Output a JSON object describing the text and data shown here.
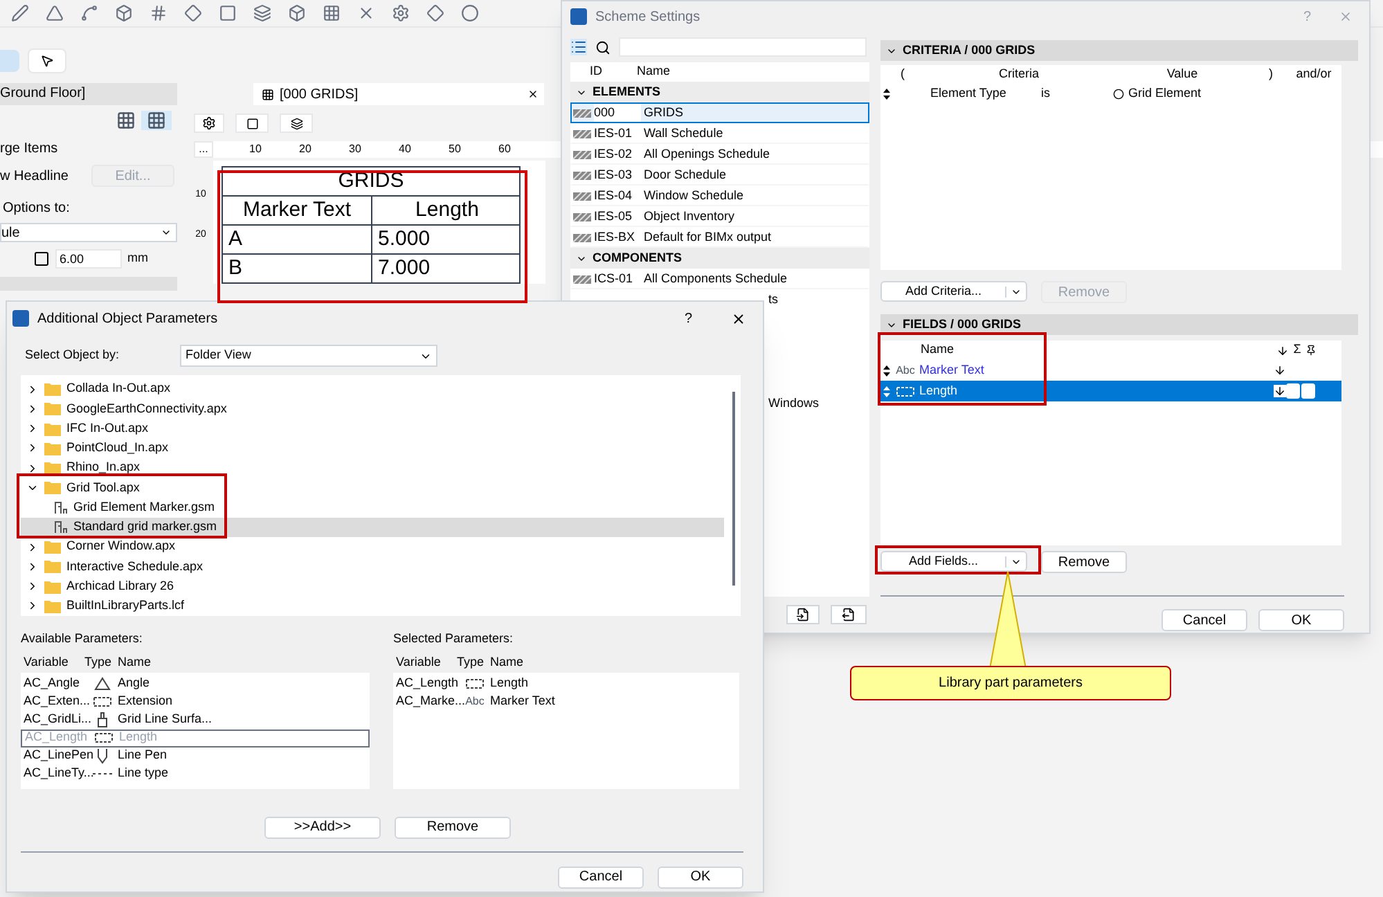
{
  "background": {
    "floor_tab": "Ground Floor]",
    "items_label": "rge Items",
    "headline_label": "w Headline",
    "edit_button": "Edit...",
    "options_label": "Options to:",
    "rule_dropdown": "ule",
    "height_value": "6.00",
    "unit": "mm",
    "view_tab": "[000 GRIDS]",
    "ruler_more": "...",
    "ruler_ticks": [
      "10",
      "20",
      "30",
      "40",
      "50",
      "60"
    ],
    "vruler_ticks": [
      "10",
      "20"
    ],
    "schedule": {
      "title": "GRIDS",
      "columns": [
        "Marker Text",
        "Length"
      ],
      "rows": [
        [
          "A",
          "5.000"
        ],
        [
          "B",
          "7.000"
        ]
      ]
    }
  },
  "scheme": {
    "title": "Scheme Settings",
    "help": "?",
    "columns": [
      "ID",
      "Name"
    ],
    "groups": [
      {
        "name": "ELEMENTS",
        "expanded": true,
        "items": [
          {
            "id": "000",
            "name": "GRIDS",
            "selected": true
          },
          {
            "id": "IES-01",
            "name": "Wall Schedule",
            "selected": false
          },
          {
            "id": "IES-02",
            "name": "All Openings Schedule",
            "selected": false
          },
          {
            "id": "IES-03",
            "name": "Door Schedule",
            "selected": false
          },
          {
            "id": "IES-04",
            "name": "Window Schedule",
            "selected": false
          },
          {
            "id": "IES-05",
            "name": "Object Inventory",
            "selected": false
          },
          {
            "id": "IES-BX",
            "name": "Default for BIMx output",
            "selected": false
          }
        ]
      },
      {
        "name": "COMPONENTS",
        "expanded": true,
        "items": [
          {
            "id": "ICS-01",
            "name": "All Components Schedule",
            "selected": false
          }
        ]
      }
    ],
    "obscured_tails": [
      "ts",
      "Windows"
    ],
    "criteria": {
      "header": "CRITERIA / 000 GRIDS",
      "columns": [
        "(",
        "Criteria",
        "Value",
        ")",
        "and/or"
      ],
      "rows": [
        {
          "field": "Element Type",
          "op": "is",
          "value": "Grid Element"
        }
      ],
      "add_button": "Add Criteria...",
      "remove_button": {
        "label": "Remove",
        "disabled": true
      }
    },
    "fields": {
      "header": "FIELDS / 000 GRIDS",
      "name_column": "Name",
      "sum_column": "Σ",
      "rows": [
        {
          "kind": "text",
          "type_label": "Abc",
          "name": "Marker Text",
          "selected": false
        },
        {
          "kind": "length",
          "name": "Length",
          "selected": true
        }
      ],
      "add_button": "Add Fields...",
      "remove_button": {
        "label": "Remove",
        "disabled": false
      }
    },
    "cancel": "Cancel",
    "ok": "OK"
  },
  "dialog": {
    "title": "Additional Object Parameters",
    "help": "?",
    "select_label": "Select Object by:",
    "select_value": "Folder View",
    "tree": [
      {
        "name": "Collada In-Out.apx",
        "expanded": false,
        "selected": false
      },
      {
        "name": "GoogleEarthConnectivity.apx",
        "expanded": false,
        "selected": false
      },
      {
        "name": "IFC In-Out.apx",
        "expanded": false,
        "selected": false
      },
      {
        "name": "PointCloud_In.apx",
        "expanded": false,
        "selected": false
      },
      {
        "name": "Rhino_In.apx",
        "expanded": false,
        "selected": false
      },
      {
        "name": "Grid Tool.apx",
        "expanded": true,
        "selected": false,
        "children": [
          {
            "name": "Grid Element Marker.gsm",
            "selected": false
          },
          {
            "name": "Standard grid marker.gsm",
            "selected": true
          }
        ]
      },
      {
        "name": "Corner Window.apx",
        "expanded": false,
        "selected": false
      },
      {
        "name": "Interactive Schedule.apx",
        "expanded": false,
        "selected": false
      },
      {
        "name": "Archicad Library 26",
        "expanded": false,
        "selected": false
      },
      {
        "name": "BuiltInLibraryParts.lcf",
        "expanded": false,
        "selected": false
      }
    ],
    "available_label": "Available Parameters:",
    "selected_label": "Selected Parameters:",
    "columns": [
      "Variable",
      "Type",
      "Name"
    ],
    "chosen_columns": [
      "Variable",
      "Type",
      "Name"
    ],
    "available": [
      {
        "variable": "AC_Angle",
        "kind": "angle",
        "name": "Angle",
        "disabled": false
      },
      {
        "variable": "AC_Exten...",
        "kind": "length",
        "name": "Extension",
        "disabled": false
      },
      {
        "variable": "AC_GridLi...",
        "kind": "material",
        "name": "Grid Line Surfa...",
        "disabled": false
      },
      {
        "variable": "AC_Length",
        "kind": "length",
        "name": "Length",
        "disabled": true
      },
      {
        "variable": "AC_LinePen",
        "kind": "pen",
        "name": "Line Pen",
        "disabled": false
      },
      {
        "variable": "AC_LineTy...",
        "kind": "linetype",
        "name": "Line type",
        "disabled": false
      }
    ],
    "chosen": [
      {
        "variable": "AC_Length",
        "kind": "length",
        "name": "Length"
      },
      {
        "variable": "AC_Marke...",
        "kind": "text",
        "type_label": "Abc",
        "name": "Marker Text"
      }
    ],
    "add_button": ">>Add>>",
    "remove_button": "Remove",
    "cancel": "Cancel",
    "ok": "OK"
  },
  "callout": "Library part parameters"
}
